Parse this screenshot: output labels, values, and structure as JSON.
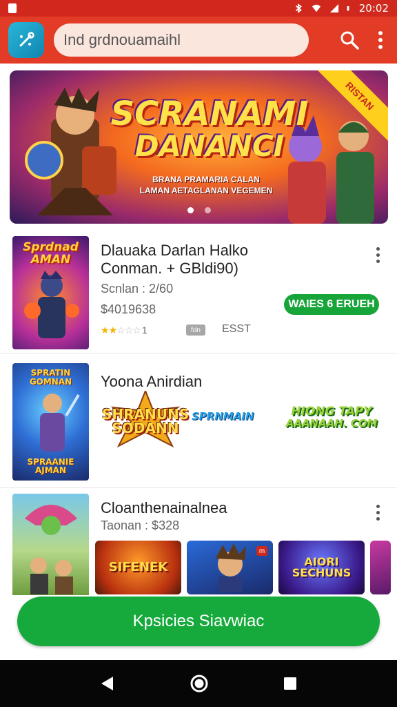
{
  "status_bar": {
    "time": "20:02"
  },
  "search": {
    "placeholder": "Ind grdnouamaihl"
  },
  "banner": {
    "title_line1": "SCRANAMI",
    "title_line2": "DANANCI",
    "subtitle_line1": "BRANA PRAMARIA CALAN",
    "subtitle_line2": "LAMAN AETAGLANAN VEGEMEN",
    "ribbon": "RISTAN",
    "slide_count": 2,
    "active_slide": 1
  },
  "items": [
    {
      "thumb_text_line1": "Sprdnad",
      "thumb_text_line2": "AMAN",
      "title_line1": "Dlauaka Darlan Halko",
      "title_line2": "Conman. + GBldi90)",
      "meta": "Scnlan : 2/60",
      "price": "$4019638",
      "rating": 2,
      "rating_suffix": "1",
      "tag": "fdn",
      "tag_label": "ESST",
      "action_label": "WAIES 6 ERUEH"
    },
    {
      "thumb_text_line1": "SPRATIN",
      "thumb_text_line2": "GOMNAN",
      "thumb_caption_line1": "SPRAANIE",
      "thumb_caption_line2": "AJMAN",
      "title": "Yoona Anirdian",
      "logo_line1": "SHRANUNS",
      "logo_line2": "SODANN",
      "logo_side": "SPRNMAIN",
      "promo_line1": "HIONG TAPY",
      "promo_line2": "AAANAAH. COM"
    },
    {
      "title": "Cloanthenainalnea",
      "meta": "Taonan : $328",
      "cards": [
        {
          "text_line1": "SIFENEK",
          "text_line2": ""
        },
        {
          "text_line1": "",
          "text_line2": "",
          "badge": "m"
        },
        {
          "text_line1": "AIORI",
          "text_line2": "SECHUNS"
        },
        {
          "text_line1": "",
          "text_line2": ""
        }
      ]
    }
  ],
  "cta": {
    "label": "Kpsicies Siavwiac"
  },
  "colors": {
    "status_bar": "#d0281c",
    "app_bar": "#e23b26",
    "accent_green": "#16a93c",
    "nav_bar": "#060606"
  },
  "icons": {
    "app_logo": "tools-icon",
    "search": "search-icon",
    "menu": "overflow-menu-icon",
    "nav_back": "back-triangle-icon",
    "nav_home": "home-circle-icon",
    "nav_recents": "recents-square-icon"
  }
}
